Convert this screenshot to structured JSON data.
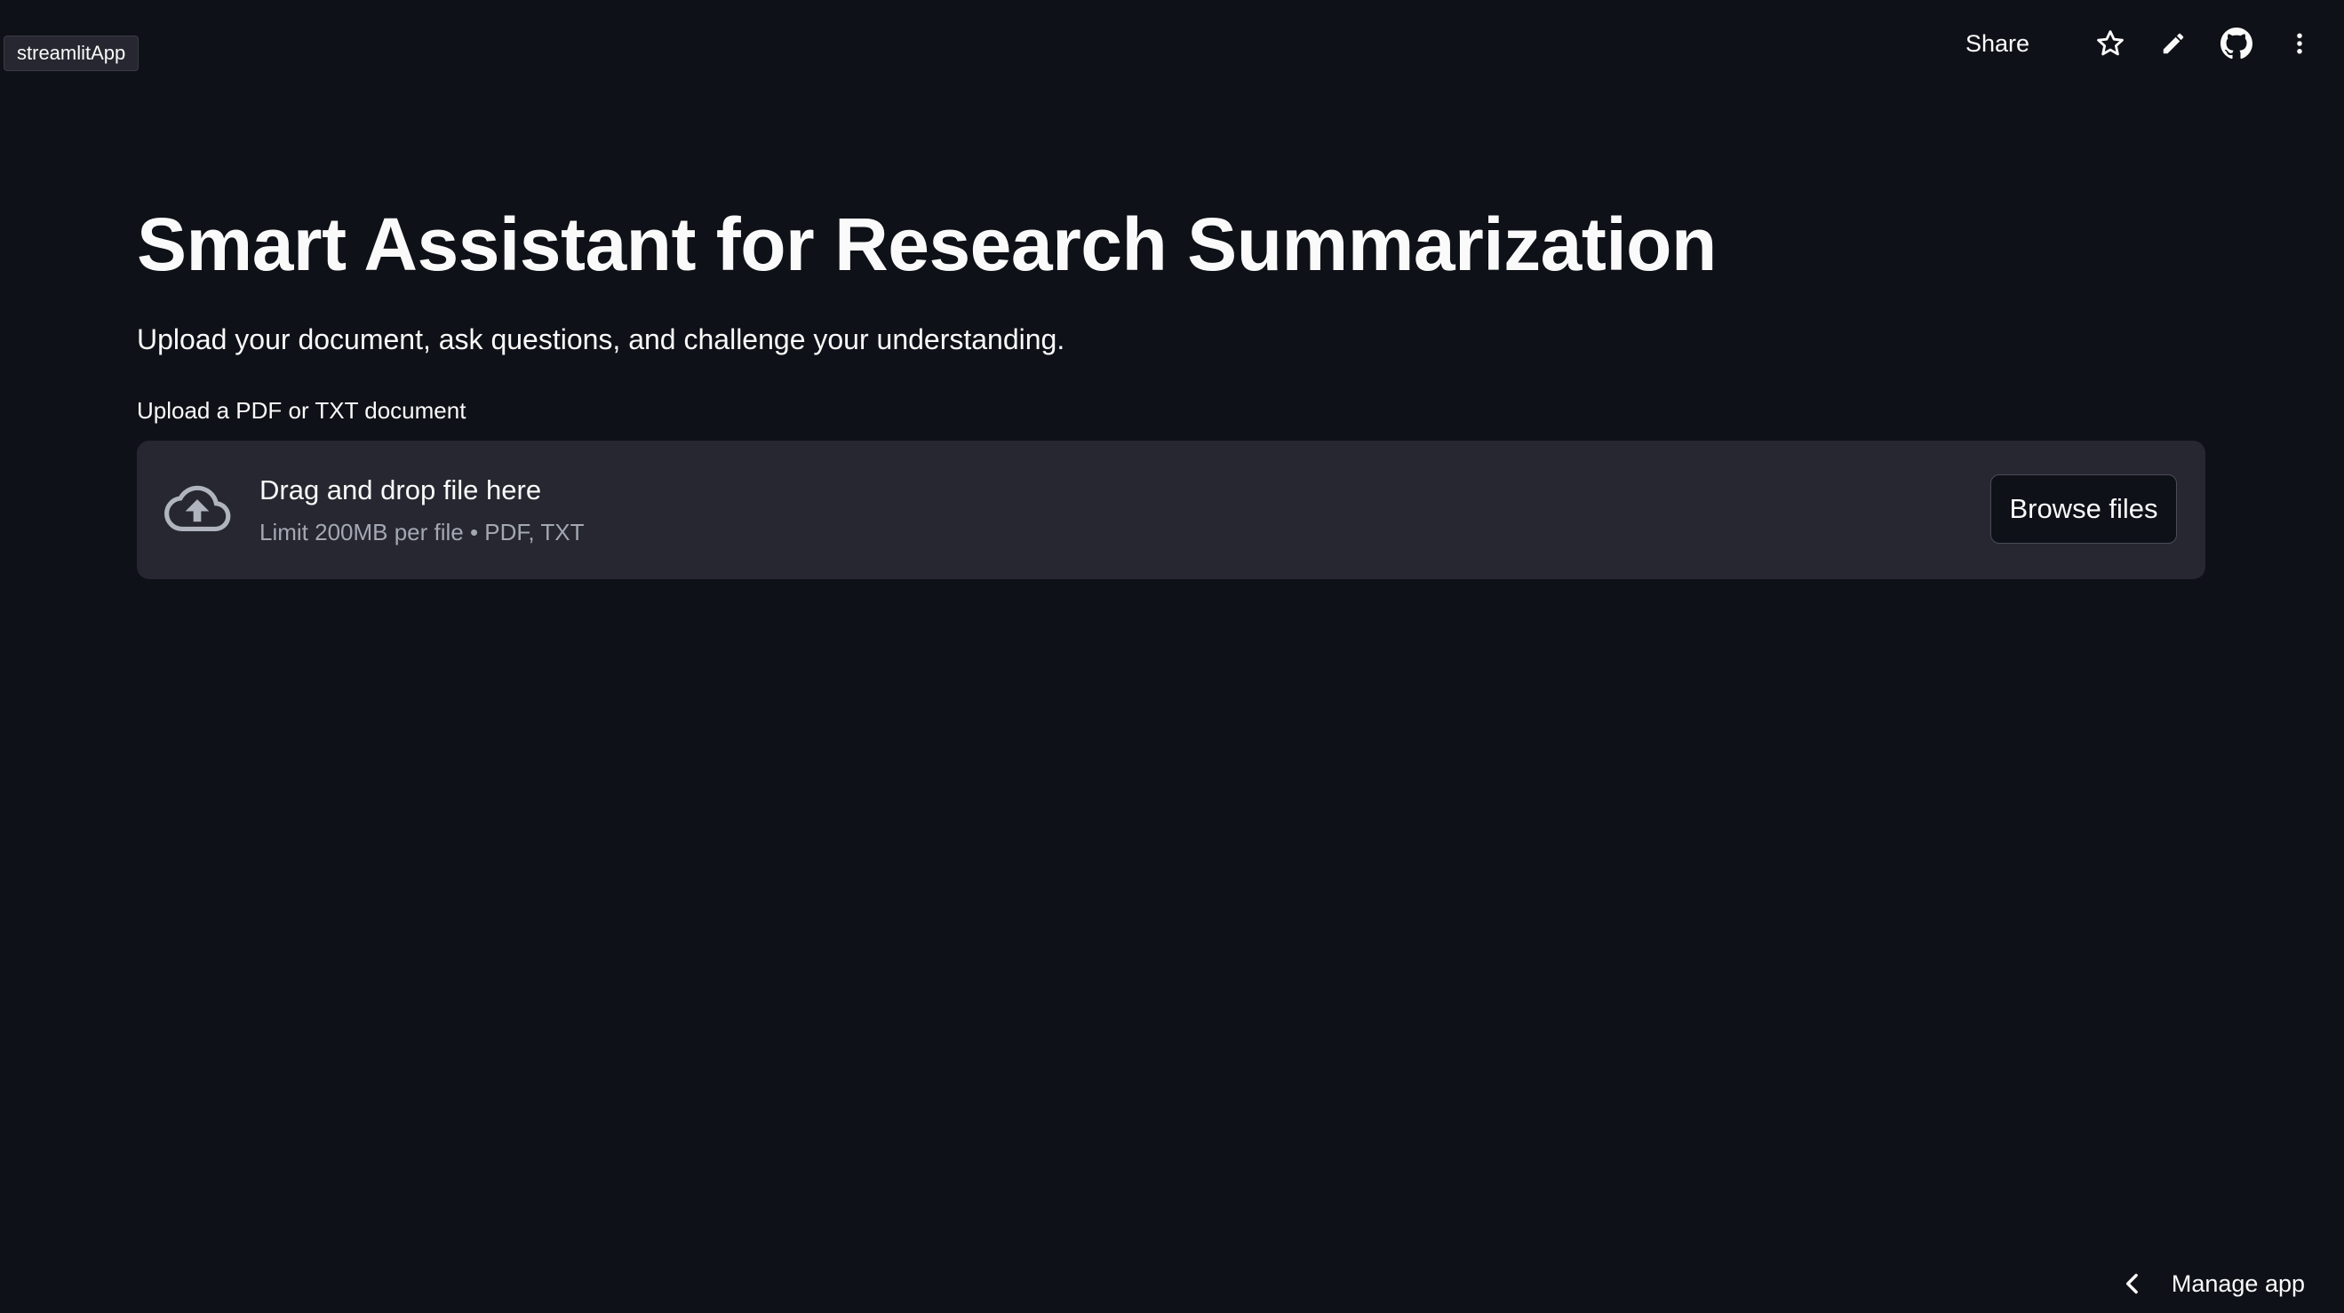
{
  "app_tag": "streamlitApp",
  "toolbar": {
    "share_label": "Share",
    "icons": [
      "star-icon",
      "pencil-icon",
      "github-icon",
      "more-vertical-icon"
    ]
  },
  "main": {
    "title": "Smart Assistant for Research Summarization",
    "subtitle": "Upload your document, ask questions, and challenge your understanding.",
    "uploader": {
      "label": "Upload a PDF or TXT document",
      "drop_title": "Drag and drop file here",
      "limit_text": "Limit 200MB per file • PDF, TXT",
      "browse_label": "Browse files",
      "icon": "cloud-upload-icon"
    }
  },
  "footer": {
    "manage_label": "Manage app",
    "icon": "chevron-left-icon"
  },
  "colors": {
    "background": "#0e1117",
    "panel": "#262730",
    "text": "#fafafa",
    "muted": "#a3a8b4"
  }
}
